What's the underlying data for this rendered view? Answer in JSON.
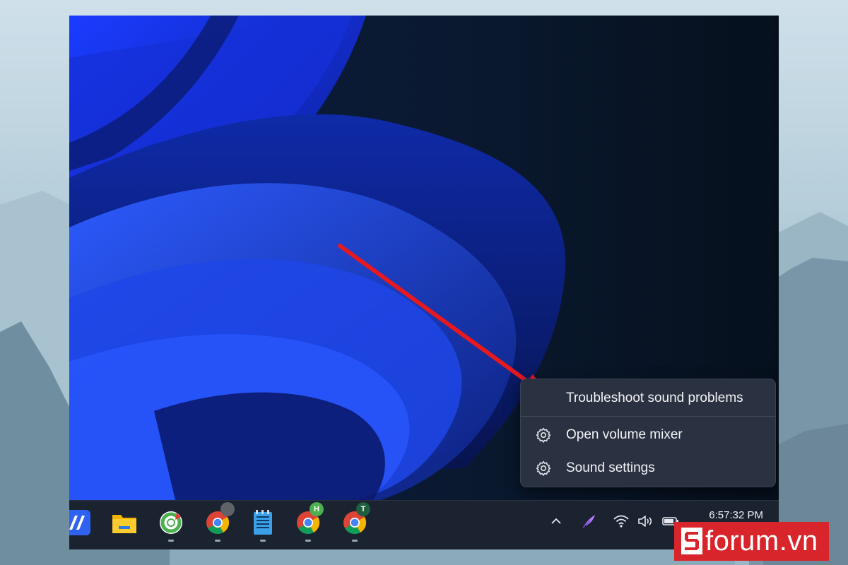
{
  "context_menu": {
    "items": [
      {
        "label": "Troubleshoot sound problems",
        "icon": ""
      },
      {
        "label": "Open volume mixer",
        "icon": "gear-icon"
      },
      {
        "label": "Sound settings",
        "icon": "gear-icon"
      }
    ]
  },
  "taskbar": {
    "apps": [
      {
        "name": "app-launcher-icon"
      },
      {
        "name": "file-explorer-icon"
      },
      {
        "name": "coccoc-browser-icon"
      },
      {
        "name": "chrome-profile-photo-icon"
      },
      {
        "name": "notepad-icon"
      },
      {
        "name": "chrome-profile-h-icon",
        "badge": "H",
        "badge_color": "#4caf50"
      },
      {
        "name": "chrome-profile-t-icon",
        "badge": "T",
        "badge_color": "#1f5e3e"
      }
    ],
    "tray": {
      "items": [
        "chevron-up-icon",
        "feather-icon",
        "wifi-icon",
        "speaker-icon",
        "battery-icon"
      ]
    },
    "clock": {
      "time": "6:57:32 PM"
    }
  },
  "watermark": {
    "logo_letter": "S",
    "text": "forum.vn"
  },
  "colors": {
    "menu_bg": "#2a3140",
    "arrow_red": "#e5191f",
    "brand_red": "#d7252b",
    "taskbar_bg": "#1b2230"
  }
}
